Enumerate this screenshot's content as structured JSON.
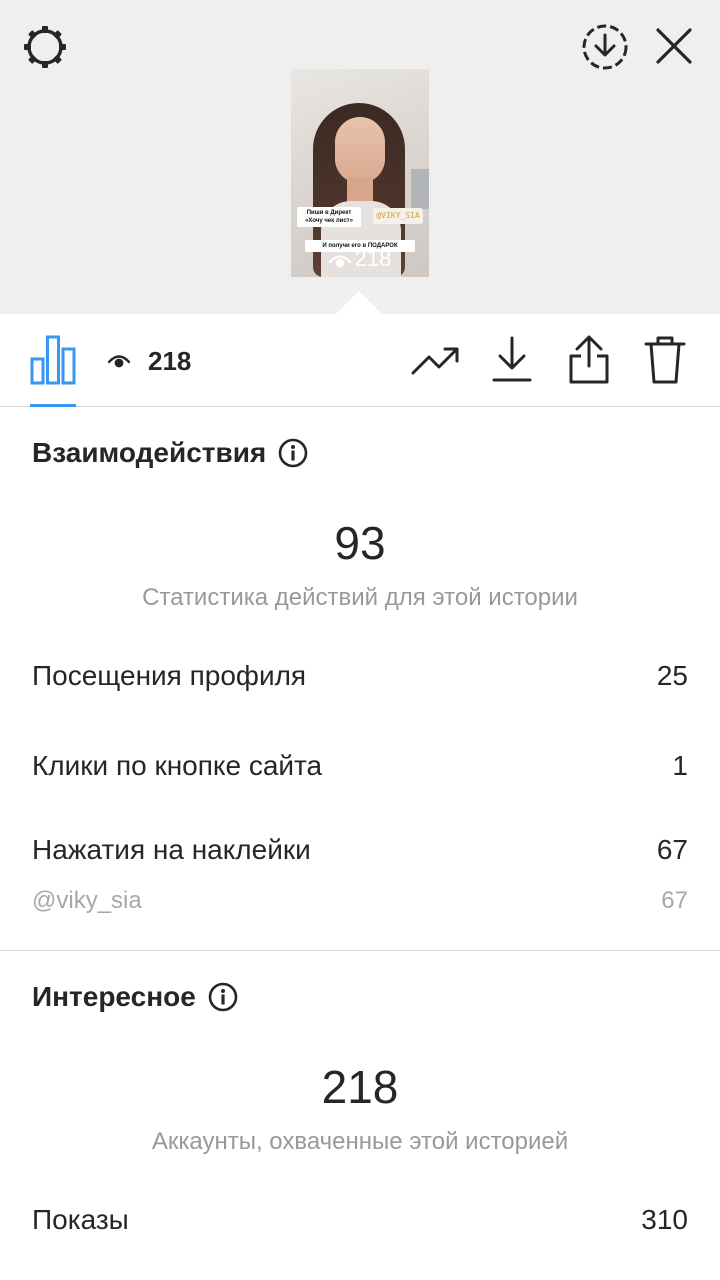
{
  "preview": {
    "sticker_line_1": "Пиши в Директ",
    "sticker_line_2": "«Хочу чек лист»",
    "sticker_handle": "@VIKY_SIA",
    "sticker_gift": "И получи его в ПОДАРОК",
    "views": "218"
  },
  "toolbar": {
    "view_count": "218",
    "active_color": "#3897f0"
  },
  "interactions": {
    "title": "Взаимодействия",
    "total": "93",
    "caption": "Статистика действий для этой истории",
    "rows": [
      {
        "label": "Посещения профиля",
        "value": "25"
      },
      {
        "label": "Клики по кнопке сайта",
        "value": "1"
      },
      {
        "label": "Нажатия на наклейки",
        "value": "67"
      }
    ],
    "sub_row": {
      "label": "@viky_sia",
      "value": "67"
    }
  },
  "discovery": {
    "title": "Интересное",
    "total": "218",
    "caption": "Аккаунты, охваченные этой историей",
    "rows": [
      {
        "label": "Показы",
        "value": "310"
      }
    ]
  }
}
